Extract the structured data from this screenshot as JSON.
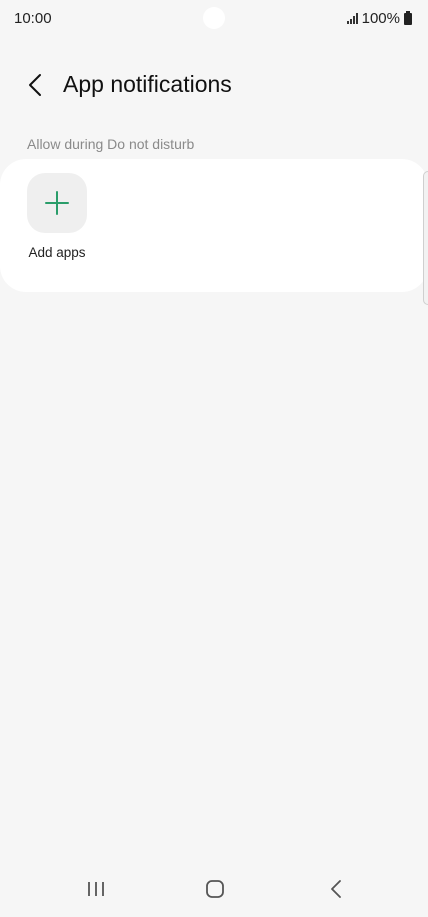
{
  "status_bar": {
    "time": "10:00",
    "battery": "100%",
    "icons": [
      "signal-icon",
      "battery-icon"
    ]
  },
  "header": {
    "back_icon": "chevron-left-icon",
    "title": "App notifications"
  },
  "section": {
    "label": "Allow during Do not disturb"
  },
  "card": {
    "add_icon": "plus-icon",
    "add_label": "Add apps"
  },
  "nav_bar": {
    "icons": [
      "recents-icon",
      "home-icon",
      "back-icon"
    ]
  },
  "colors": {
    "background": "#f6f6f6",
    "card": "#ffffff",
    "accent_green": "#2a9d6a",
    "secondary_text": "#8a8a8a"
  }
}
